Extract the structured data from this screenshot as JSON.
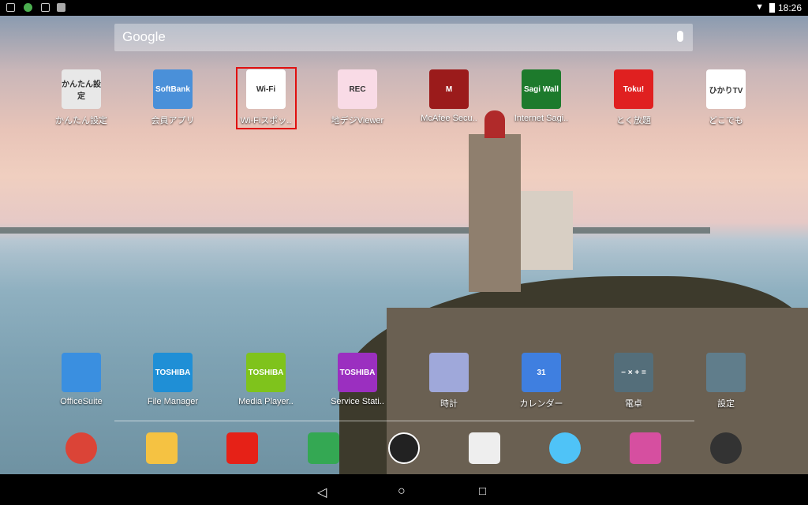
{
  "status_bar": {
    "time": "18:26",
    "icons": [
      "image-icon",
      "android-icon",
      "notification-icon",
      "notification-icon",
      "wifi-icon",
      "battery-icon"
    ]
  },
  "search": {
    "placeholder": "Google",
    "icon": "mic-icon"
  },
  "top_row": [
    {
      "label": "かんたん設定",
      "badge": "かんたん設定",
      "color": "#e8e8e8"
    },
    {
      "label": "会員アプリ",
      "badge": "SoftBank",
      "color": "#4a90d9"
    },
    {
      "label": "Wi-Fiスポッ..",
      "badge": "Wi-Fi",
      "color": "#ffffff"
    },
    {
      "label": "地デジViewer",
      "badge": "REC",
      "color": "#f9dbe6"
    },
    {
      "label": "McAfee Secu..",
      "badge": "M",
      "color": "#9b1b1b"
    },
    {
      "label": "Internet Sagi..",
      "badge": "Sagi Wall",
      "color": "#1d7a2c"
    },
    {
      "label": "とく放題",
      "badge": "Toku!",
      "color": "#e02020"
    },
    {
      "label": "どこでも",
      "badge": "ひかりTV",
      "color": "#ffffff"
    }
  ],
  "second_row": [
    {
      "label": "OfficeSuite",
      "badge": "",
      "color": "#3a8fe0"
    },
    {
      "label": "File Manager",
      "badge": "TOSHIBA",
      "color": "#1f8fd6"
    },
    {
      "label": "Media Player..",
      "badge": "TOSHIBA",
      "color": "#7fc31c"
    },
    {
      "label": "Service Stati..",
      "badge": "TOSHIBA",
      "color": "#9b2fc0"
    },
    {
      "label": "時計",
      "badge": "",
      "color": "#9fa8da"
    },
    {
      "label": "カレンダー",
      "badge": "31",
      "color": "#3f7fe0"
    },
    {
      "label": "電卓",
      "badge": "− × + =",
      "color": "#546e7a"
    },
    {
      "label": "設定",
      "badge": "",
      "color": "#607d8b"
    }
  ],
  "dock": [
    {
      "name": "chrome-icon",
      "color": "#db4437"
    },
    {
      "name": "email-icon",
      "color": "#f5c242"
    },
    {
      "name": "youtube-icon",
      "color": "#e62117"
    },
    {
      "name": "maps-icon",
      "color": "#34a853"
    },
    {
      "name": "app-drawer-icon",
      "color": "#222222"
    },
    {
      "name": "play-store-icon",
      "color": "#eeeeee"
    },
    {
      "name": "photos-icon",
      "color": "#4fc3f7"
    },
    {
      "name": "gallery-icon",
      "color": "#d64fa0"
    },
    {
      "name": "chrome-alt-icon",
      "color": "#333333"
    }
  ],
  "nav": {
    "back": "◁",
    "home": "○",
    "recents": "□"
  }
}
